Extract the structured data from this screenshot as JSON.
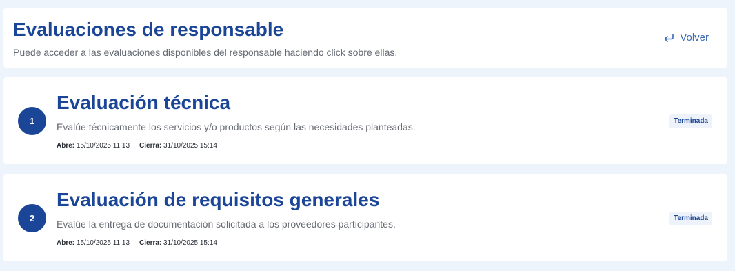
{
  "header": {
    "title": "Evaluaciones de responsable",
    "subtitle": "Puede acceder a las evaluaciones disponibles del responsable haciendo click sobre ellas.",
    "back_label": "Volver"
  },
  "evaluations": [
    {
      "number": "1",
      "title": "Evaluación técnica",
      "description": "Evalúe técnicamente los servicios y/o productos según las necesidades planteadas.",
      "opens_label": "Abre:",
      "opens_value": "15/10/2025 11:13",
      "closes_label": "Cierra:",
      "closes_value": "31/10/2025 15:14",
      "status": "Terminada"
    },
    {
      "number": "2",
      "title": "Evaluación de requisitos generales",
      "description": "Evalúe la entrega de documentación solicitada a los proveedores participantes.",
      "opens_label": "Abre:",
      "opens_value": "15/10/2025 11:13",
      "closes_label": "Cierra:",
      "closes_value": "31/10/2025 15:14",
      "status": "Terminada"
    }
  ],
  "icons": {
    "back": "return-arrow-icon"
  },
  "colors": {
    "primary": "#1b4597",
    "link": "#3b6ab6",
    "background": "#eef4fb",
    "badge_bg": "#eef3fb"
  }
}
